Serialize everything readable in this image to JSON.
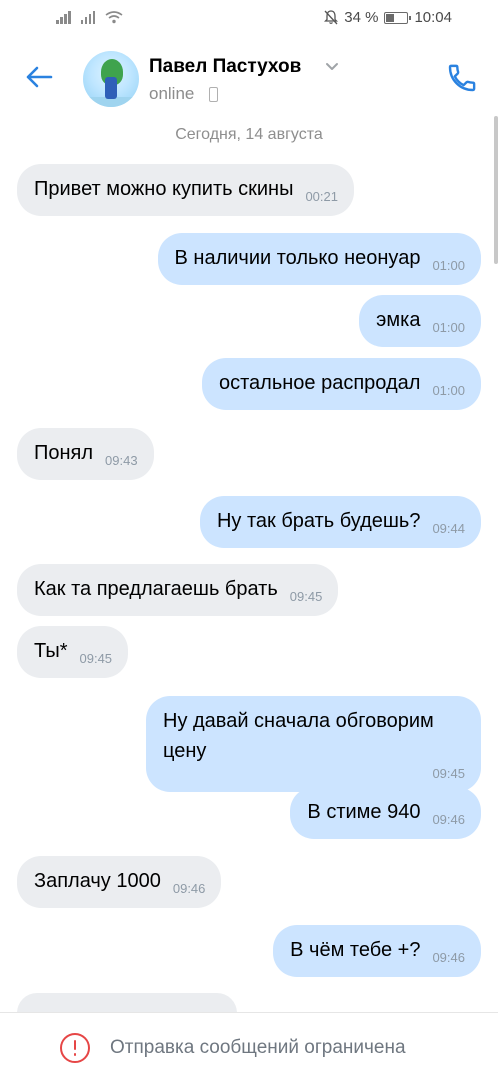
{
  "status_bar": {
    "battery": "34 %",
    "battery_level": 0.34,
    "time": "10:04"
  },
  "header": {
    "contact_name": "Павел Пастухов",
    "status": "online"
  },
  "chat": {
    "date_divider": "Сегодня, 14 августа",
    "messages": [
      {
        "dir": "in",
        "text": "Привет можно купить скины",
        "time": "00:21"
      },
      {
        "dir": "out",
        "text": "В наличии только неонуар",
        "time": "01:00"
      },
      {
        "dir": "out",
        "text": "эмка",
        "time": "01:00"
      },
      {
        "dir": "out",
        "text": "остальное распродал",
        "time": "01:00"
      },
      {
        "dir": "in",
        "text": "Понял",
        "time": "09:43"
      },
      {
        "dir": "out",
        "text": "Ну так брать будешь?",
        "time": "09:44"
      },
      {
        "dir": "in",
        "text": "Как та предлагаешь брать",
        "time": "09:45"
      },
      {
        "dir": "in",
        "text": "Ты*",
        "time": "09:45"
      },
      {
        "dir": "out",
        "text_line1": "Ну давай сначала обговорим",
        "text_line2": "цену",
        "time": "09:45"
      },
      {
        "dir": "out",
        "text": "В стиме 940",
        "time": "09:46"
      },
      {
        "dir": "in",
        "text": "Заплачу 1000",
        "time": "09:46"
      },
      {
        "dir": "out",
        "text": "В чём тебе +?",
        "time": "09:46"
      }
    ]
  },
  "footer": {
    "notice": "Отправка сообщений ограничена"
  },
  "colors": {
    "accent": "#2a82e0",
    "incoming_bubble": "#ebedf0",
    "outgoing_bubble": "#cce4ff",
    "alert": "#e64646"
  }
}
